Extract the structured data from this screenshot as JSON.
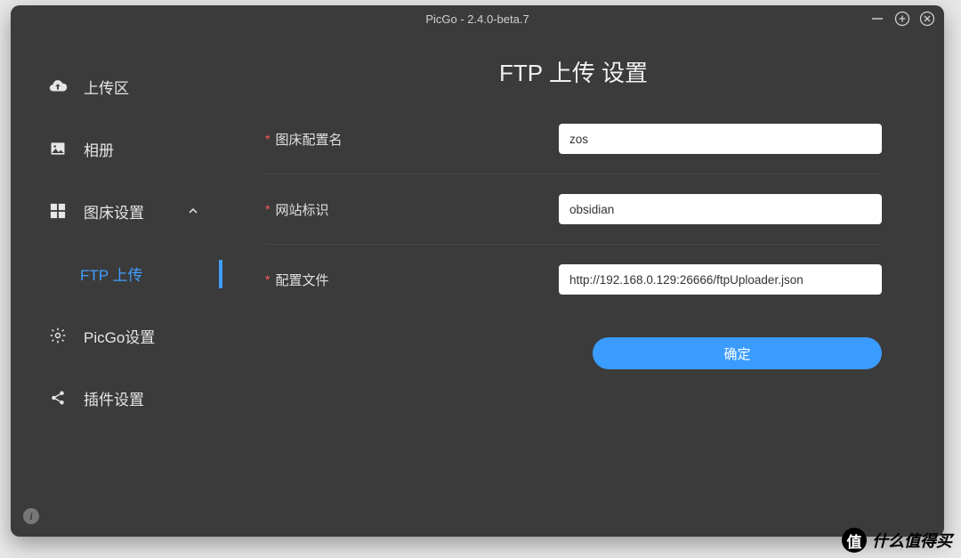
{
  "window": {
    "title": "PicGo - 2.4.0-beta.7"
  },
  "sidebar": {
    "upload": "上传区",
    "gallery": "相册",
    "picbed": "图床设置",
    "ftp": "FTP 上传",
    "settings": "PicGo设置",
    "plugins": "插件设置"
  },
  "main": {
    "title": "FTP 上传 设置",
    "fields": {
      "configName": {
        "label": "图床配置名",
        "value": "zos"
      },
      "siteId": {
        "label": "网站标识",
        "value": "obsidian"
      },
      "configFile": {
        "label": "配置文件",
        "value": "http://192.168.0.129:26666/ftpUploader.json"
      }
    },
    "submit": "确定"
  },
  "watermark": {
    "badge": "值",
    "text": "什么值得买"
  }
}
